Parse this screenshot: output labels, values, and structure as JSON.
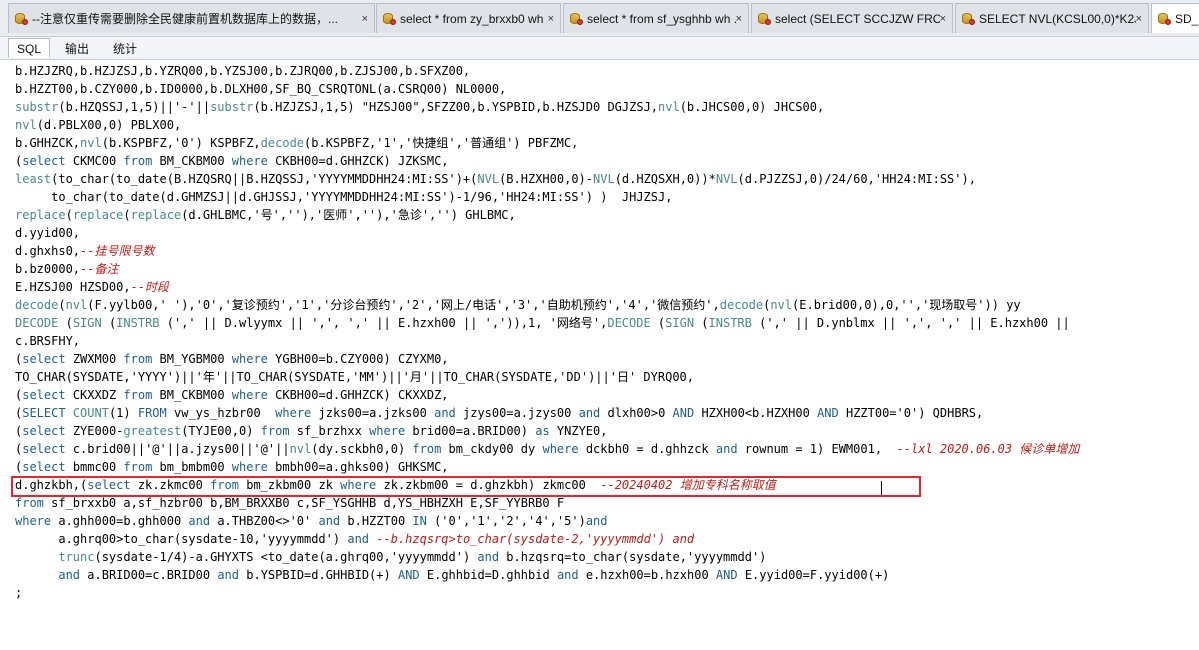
{
  "tabs": [
    {
      "label": "--注意仅重传需要删除全民健康前置机数据库上的数据，...",
      "close": "×",
      "active": false
    },
    {
      "label": "select * from zy_brxxb0 wh ...",
      "close": "×",
      "active": false
    },
    {
      "label": "select * from sf_ysghhb wh ...",
      "close": "×",
      "active": false
    },
    {
      "label": "select (SELECT SCCJZW FROM ...",
      "close": "×",
      "active": false
    },
    {
      "label": "SELECT NVL(KCSL00,0)*K2J00 ...",
      "close": "×",
      "active": false
    },
    {
      "label": "SD_...",
      "close": "",
      "active": true
    }
  ],
  "subtabs": [
    {
      "label": "SQL",
      "active": true
    },
    {
      "label": "输出",
      "active": false
    },
    {
      "label": "统计",
      "active": false
    }
  ],
  "code": [
    [
      [
        "p",
        "b.HZJZRQ,b.HZJZSJ,b.YZRQ00,b.YZSJ00,b.ZJRQ00,b.ZJSJ00,b.SFXZ00,"
      ]
    ],
    [
      [
        "p",
        "b.HZZT00,b.CZY000,b.ID0000,b.DLXH00,SF_BQ_CSRQTONL(a.CSRQ00) NL0000,"
      ]
    ],
    [
      [
        "f",
        "substr"
      ],
      [
        "p",
        "(b.HZQSSJ,1,5)||'-'||"
      ],
      [
        "f",
        "substr"
      ],
      [
        "p",
        "(b.HZJZSJ,1,5) \"HZSJ00\",SFZZ00,b.YSPBID,b.HZSJD0 DGJZSJ,"
      ],
      [
        "f",
        "nvl"
      ],
      [
        "p",
        "(b.JHCS00,0) JHCS00,"
      ]
    ],
    [
      [
        "f",
        "nvl"
      ],
      [
        "p",
        "(d.PBLX00,0) PBLX00,"
      ]
    ],
    [
      [
        "p",
        "b.GHHZCK,"
      ],
      [
        "f",
        "nvl"
      ],
      [
        "p",
        "(b.KSPBFZ,'0') KSPBFZ,"
      ],
      [
        "f",
        "decode"
      ],
      [
        "p",
        "(b.KSPBFZ,'1','快捷组','普通组') PBFZMC,"
      ]
    ],
    [
      [
        "p",
        "("
      ],
      [
        "k",
        "select"
      ],
      [
        "p",
        " CKMC00 "
      ],
      [
        "k",
        "from"
      ],
      [
        "p",
        " BM_CKBM00 "
      ],
      [
        "k",
        "where"
      ],
      [
        "p",
        " CKBH00=d.GHHZCK) JZKSMC,"
      ]
    ],
    [
      [
        "f",
        "least"
      ],
      [
        "p",
        "(to_char(to_date(B.HZQSRQ||B.HZQSSJ,'YYYYMMDDHH24:MI:SS')+("
      ],
      [
        "f",
        "NVL"
      ],
      [
        "p",
        "(B.HZXH00,0)-"
      ],
      [
        "f",
        "NVL"
      ],
      [
        "p",
        "(d.HZQSXH,0))*"
      ],
      [
        "f",
        "NVL"
      ],
      [
        "p",
        "(d.PJZZSJ,0)/24/60,'HH24:MI:SS'),"
      ]
    ],
    [
      [
        "p",
        "     to_char(to_date(d.GHMZSJ||d.GHJSSJ,'YYYYMMDDHH24:MI:SS')-1/96,'HH24:MI:SS') )  JHJZSJ,"
      ]
    ],
    [
      [
        "f",
        "replace"
      ],
      [
        "p",
        "("
      ],
      [
        "f",
        "replace"
      ],
      [
        "p",
        "("
      ],
      [
        "f",
        "replace"
      ],
      [
        "p",
        "(d.GHLBMC,'号',''),'医师',''),'急诊','') GHLBMC,"
      ]
    ],
    [
      [
        "p",
        "d.yyid00,"
      ]
    ],
    [
      [
        "p",
        "d.ghxhs0,"
      ],
      [
        "c",
        "--挂号限号数"
      ]
    ],
    [
      [
        "p",
        "b.bz0000,"
      ],
      [
        "c",
        "--备注"
      ]
    ],
    [
      [
        "p",
        "E.HZSJ00 HZSD00,"
      ],
      [
        "c",
        "--时段"
      ]
    ],
    [
      [
        "f",
        "decode"
      ],
      [
        "p",
        "("
      ],
      [
        "f",
        "nvl"
      ],
      [
        "p",
        "(F.yylb00,' '),'0','复诊预约','1','分诊台预约','2','网上/电话','3','自助机预约','4','微信预约',"
      ],
      [
        "f",
        "decode"
      ],
      [
        "p",
        "("
      ],
      [
        "f",
        "nvl"
      ],
      [
        "p",
        "(E.brid00,0),0,'','现场取号')) yy"
      ]
    ],
    [
      [
        "f",
        "DECODE"
      ],
      [
        "p",
        " ("
      ],
      [
        "f",
        "SIGN"
      ],
      [
        "p",
        " ("
      ],
      [
        "f",
        "INSTRB"
      ],
      [
        "p",
        " (',' || D.wlyymx || ',', ',' || E.hzxh00 || ',')),1, '网络号',"
      ],
      [
        "f",
        "DECODE"
      ],
      [
        "p",
        " ("
      ],
      [
        "f",
        "SIGN"
      ],
      [
        "p",
        " ("
      ],
      [
        "f",
        "INSTRB"
      ],
      [
        "p",
        " (',' || D.ynblmx || ',', ',' || E.hzxh00 ||"
      ]
    ],
    [
      [
        "p",
        "c.BRSFHY,"
      ]
    ],
    [
      [
        "p",
        "("
      ],
      [
        "k",
        "select"
      ],
      [
        "p",
        " ZWXM00 "
      ],
      [
        "k",
        "from"
      ],
      [
        "p",
        " BM_YGBM00 "
      ],
      [
        "k",
        "where"
      ],
      [
        "p",
        " YGBH00=b.CZY000) CZYXM0,"
      ]
    ],
    [
      [
        "p",
        "TO_CHAR(SYSDATE,'YYYY')||'年'||TO_CHAR(SYSDATE,'MM')||'月'||TO_CHAR(SYSDATE,'DD')||'日' DYRQ00,"
      ]
    ],
    [
      [
        "p",
        "("
      ],
      [
        "k",
        "select"
      ],
      [
        "p",
        " CKXXDZ "
      ],
      [
        "k",
        "from"
      ],
      [
        "p",
        " BM_CKBM00 "
      ],
      [
        "k",
        "where"
      ],
      [
        "p",
        " CKBH00=d.GHHZCK) CKXXDZ,"
      ]
    ],
    [
      [
        "p",
        "("
      ],
      [
        "k",
        "SELECT"
      ],
      [
        "p",
        " "
      ],
      [
        "f",
        "COUNT"
      ],
      [
        "p",
        "(1) "
      ],
      [
        "k",
        "FROM"
      ],
      [
        "p",
        " vw_ys_hzbr00  "
      ],
      [
        "k",
        "where"
      ],
      [
        "p",
        " jzks00=a.jzks00 "
      ],
      [
        "k",
        "and"
      ],
      [
        "p",
        " jzys00=a.jzys00 "
      ],
      [
        "k",
        "and"
      ],
      [
        "p",
        " dlxh00>0 "
      ],
      [
        "k",
        "AND"
      ],
      [
        "p",
        " HZXH00<b.HZXH00 "
      ],
      [
        "k",
        "AND"
      ],
      [
        "p",
        " HZZT00='0') QDHBRS,"
      ]
    ],
    [
      [
        "p",
        "("
      ],
      [
        "k",
        "select"
      ],
      [
        "p",
        " ZYE000-"
      ],
      [
        "f",
        "greatest"
      ],
      [
        "p",
        "(TYJE00,0) "
      ],
      [
        "k",
        "from"
      ],
      [
        "p",
        " sf_brzhxx "
      ],
      [
        "k",
        "where"
      ],
      [
        "p",
        " brid00=a.BRID00) "
      ],
      [
        "k",
        "as"
      ],
      [
        "p",
        " YNZYE0,"
      ]
    ],
    [
      [
        "p",
        "("
      ],
      [
        "k",
        "select"
      ],
      [
        "p",
        " c.brid00||'@'||a.jzys00||'@'||"
      ],
      [
        "f",
        "nvl"
      ],
      [
        "p",
        "(dy.sckbh0,0) "
      ],
      [
        "k",
        "from"
      ],
      [
        "p",
        " bm_ckdy00 dy "
      ],
      [
        "k",
        "where"
      ],
      [
        "p",
        " dckbh0 = d.ghhzck "
      ],
      [
        "k",
        "and"
      ],
      [
        "p",
        " rownum = 1) EWM001,  "
      ],
      [
        "c",
        "--lxl 2020.06.03 候诊单增加"
      ]
    ],
    [
      [
        "p",
        "("
      ],
      [
        "k",
        "select"
      ],
      [
        "p",
        " bmmc00 "
      ],
      [
        "k",
        "from"
      ],
      [
        "p",
        " bm_bmbm00 "
      ],
      [
        "k",
        "where"
      ],
      [
        "p",
        " bmbh00=a.ghks00) GHKSMC,"
      ]
    ],
    [
      [
        "p",
        "d.ghzkbh,("
      ],
      [
        "k",
        "select"
      ],
      [
        "p",
        " zk.zkmc00 "
      ],
      [
        "k",
        "from"
      ],
      [
        "p",
        " bm_zkbm00 zk "
      ],
      [
        "k",
        "where"
      ],
      [
        "p",
        " zk.zkbm00 = d.ghzkbh) zkmc00  "
      ],
      [
        "c",
        "--20240402 增加专科名称取值"
      ]
    ],
    [
      [
        "k",
        "from"
      ],
      [
        "p",
        " sf_brxxb0 a,sf_hzbr00 b,BM_BRXXB0 c,SF_YSGHHB d,YS_HBHZXH E,SF_YYBRB0 F"
      ]
    ],
    [
      [
        "k",
        "where"
      ],
      [
        "p",
        " a.ghh000=b.ghh000 "
      ],
      [
        "k",
        "and"
      ],
      [
        "p",
        " a.THBZ00<>'0' "
      ],
      [
        "k",
        "and"
      ],
      [
        "p",
        " b.HZZT00 "
      ],
      [
        "k",
        "IN"
      ],
      [
        "p",
        " ('0','1','2','4','5')"
      ],
      [
        "k",
        "and"
      ]
    ],
    [
      [
        "p",
        "      a.ghrq00>to_char(sysdate-10,'yyyymmdd') "
      ],
      [
        "k",
        "and"
      ],
      [
        "p",
        " "
      ],
      [
        "c",
        "--b.hzqsrq>to_char(sysdate-2,'yyyymmdd') and"
      ]
    ],
    [
      [
        "p",
        "      "
      ],
      [
        "f",
        "trunc"
      ],
      [
        "p",
        "(sysdate-1/4)-a.GHYXTS <to_date(a.ghrq00,'yyyymmdd') "
      ],
      [
        "k",
        "and"
      ],
      [
        "p",
        " b.hzqsrq=to_char(sysdate,'yyyymmdd')"
      ]
    ],
    [
      [
        "p",
        "      "
      ],
      [
        "k",
        "and"
      ],
      [
        "p",
        " a.BRID00=c.BRID00 "
      ],
      [
        "k",
        "and"
      ],
      [
        "p",
        " b.YSPBID=d.GHHBID(+) "
      ],
      [
        "k",
        "AND"
      ],
      [
        "p",
        " E.ghhbid=D.ghhbid "
      ],
      [
        "k",
        "and"
      ],
      [
        "p",
        " e.hzxh00=b.hzxh00 "
      ],
      [
        "k",
        "AND"
      ],
      [
        "p",
        " E.yyid00=F.yyid00(+)"
      ]
    ],
    [
      [
        "p",
        ";"
      ]
    ]
  ]
}
